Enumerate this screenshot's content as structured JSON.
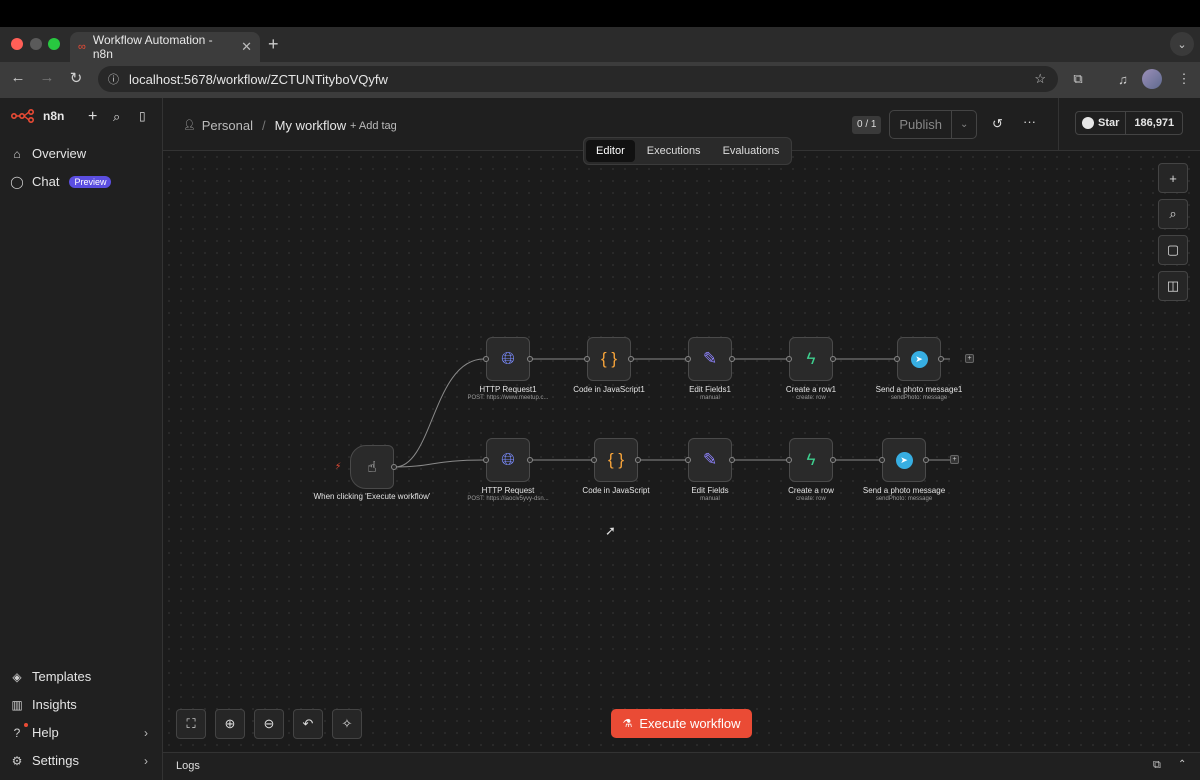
{
  "browser": {
    "tab_title": "Workflow Automation - n8n",
    "url": "localhost:5678/workflow/ZCTUNTityboVQyfw"
  },
  "sidebar": {
    "brand": "n8n",
    "items_top": [
      {
        "label": "Overview",
        "icon": "home-icon"
      },
      {
        "label": "Chat",
        "icon": "chat-icon",
        "badge": "Preview"
      }
    ],
    "items_bottom": [
      {
        "label": "Templates",
        "icon": "templates-icon"
      },
      {
        "label": "Insights",
        "icon": "insights-icon"
      },
      {
        "label": "Help",
        "icon": "help-icon"
      },
      {
        "label": "Settings",
        "icon": "settings-icon"
      }
    ]
  },
  "header": {
    "breadcrumb_project": "Personal",
    "breadcrumb_sep": "/",
    "workflow_name": "My workflow",
    "add_tag": "+ Add tag",
    "version_counter": "0 / 1",
    "publish_label": "Publish",
    "github_star": "Star",
    "github_count": "186,971",
    "tabs": [
      "Editor",
      "Executions",
      "Evaluations"
    ]
  },
  "nodes": {
    "trigger": {
      "label": "When clicking 'Execute workflow'"
    },
    "row1": [
      {
        "label": "HTTP Request1",
        "sub": "POST: https://www.meetup.c..."
      },
      {
        "label": "Code in JavaScript1",
        "sub": ""
      },
      {
        "label": "Edit Fields1",
        "sub": "manual"
      },
      {
        "label": "Create a row1",
        "sub": "create: row"
      },
      {
        "label": "Send a photo message1",
        "sub": "sendPhoto: message"
      }
    ],
    "row2": [
      {
        "label": "HTTP Request",
        "sub": "POST: https://iaociv5yvy-dsn..."
      },
      {
        "label": "Code in JavaScript",
        "sub": ""
      },
      {
        "label": "Edit Fields",
        "sub": "manual"
      },
      {
        "label": "Create a row",
        "sub": "create: row"
      },
      {
        "label": "Send a photo message",
        "sub": "sendPhoto: message"
      }
    ]
  },
  "canvas": {
    "execute_label": "Execute workflow"
  },
  "logs": {
    "label": "Logs"
  },
  "colors": {
    "accent": "#ea4b35",
    "http": "#7b8cff",
    "code": "#f7a43a",
    "edit": "#8f84ff",
    "supabase": "#3ecf8e",
    "telegram": "#37aee2",
    "badge": "#5b4ee0"
  }
}
